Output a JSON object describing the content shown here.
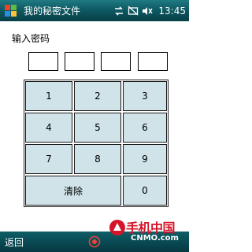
{
  "window": {
    "title": "我的秘密文件",
    "time": "13:45"
  },
  "status_icons": [
    "signal-sync-icon",
    "no-connection-icon",
    "volume-mute-icon"
  ],
  "prompt": "输入密码",
  "keypad": {
    "keys": [
      "1",
      "2",
      "3",
      "4",
      "5",
      "6",
      "7",
      "8",
      "9",
      "清除",
      "0"
    ]
  },
  "bottom": {
    "left_softkey": "返回"
  },
  "watermark": {
    "main": "手机中国",
    "sub": "CNMO.com"
  },
  "colors": {
    "titlebar": "#0e5a63",
    "key_fill": "#cfe3e8",
    "watermark": "#d4142a"
  }
}
